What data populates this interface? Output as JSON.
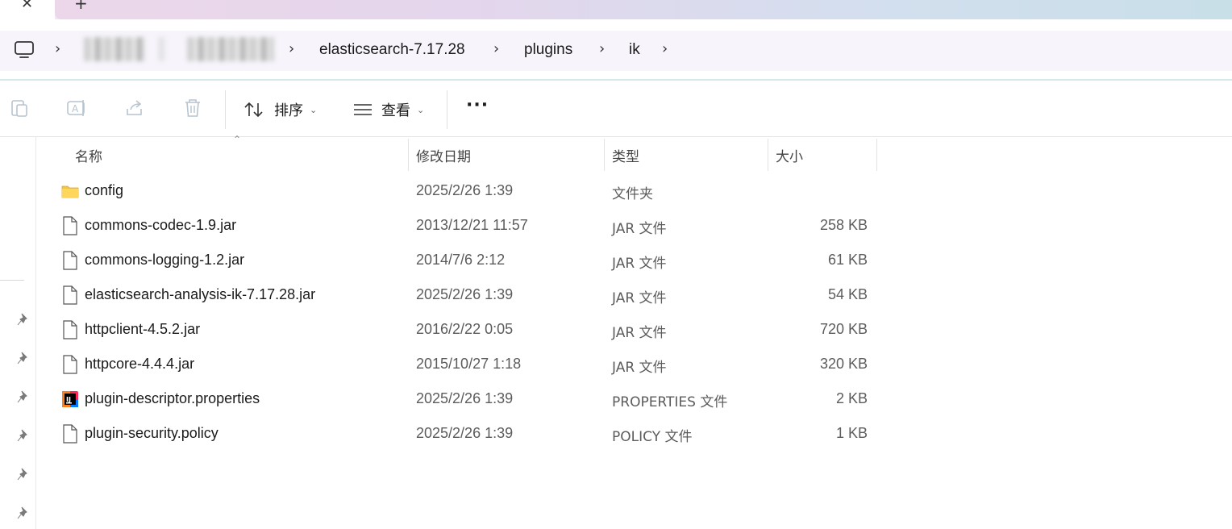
{
  "window": {
    "tab_close_glyph": "✕",
    "new_tab_glyph": "+"
  },
  "breadcrumb": {
    "items": [
      {
        "label": "elasticsearch-7.17.28"
      },
      {
        "label": "plugins"
      },
      {
        "label": "ik"
      }
    ]
  },
  "toolbar": {
    "sort_label": "排序",
    "view_label": "查看",
    "more_label": "···"
  },
  "columns": {
    "name": "名称",
    "modified": "修改日期",
    "type": "类型",
    "size": "大小"
  },
  "files": [
    {
      "name": "config",
      "modified": "2025/2/26 1:39",
      "type": "文件夹",
      "size": "",
      "icon": "folder-icon"
    },
    {
      "name": "commons-codec-1.9.jar",
      "modified": "2013/12/21 11:57",
      "type": "JAR 文件",
      "size": "258 KB",
      "icon": "file-icon"
    },
    {
      "name": "commons-logging-1.2.jar",
      "modified": "2014/7/6 2:12",
      "type": "JAR 文件",
      "size": "61 KB",
      "icon": "file-icon"
    },
    {
      "name": "elasticsearch-analysis-ik-7.17.28.jar",
      "modified": "2025/2/26 1:39",
      "type": "JAR 文件",
      "size": "54 KB",
      "icon": "file-icon"
    },
    {
      "name": "httpclient-4.5.2.jar",
      "modified": "2016/2/22 0:05",
      "type": "JAR 文件",
      "size": "720 KB",
      "icon": "file-icon"
    },
    {
      "name": "httpcore-4.4.4.jar",
      "modified": "2015/10/27 1:18",
      "type": "JAR 文件",
      "size": "320 KB",
      "icon": "file-icon"
    },
    {
      "name": "plugin-descriptor.properties",
      "modified": "2025/2/26 1:39",
      "type": "PROPERTIES 文件",
      "size": "2 KB",
      "icon": "intellij-file-icon"
    },
    {
      "name": "plugin-security.policy",
      "modified": "2025/2/26 1:39",
      "type": "POLICY 文件",
      "size": "1 KB",
      "icon": "file-icon"
    }
  ],
  "colors": {
    "folder": "#f5c542",
    "accent_line": "#d6e8ee"
  }
}
